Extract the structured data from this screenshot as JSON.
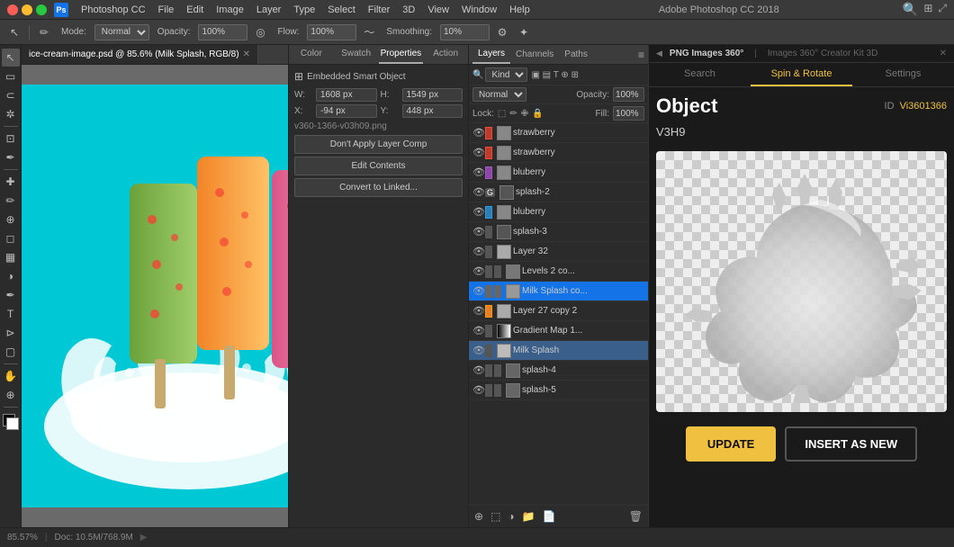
{
  "app": {
    "title": "Adobe Photoshop CC 2018",
    "name": "Photoshop CC"
  },
  "menu": {
    "items": [
      "Photoshop CC",
      "File",
      "Edit",
      "Image",
      "Layer",
      "Type",
      "Select",
      "Filter",
      "3D",
      "View",
      "Window",
      "Help"
    ]
  },
  "toolbar": {
    "mode_label": "Mode:",
    "mode_value": "Normal",
    "opacity_label": "Opacity:",
    "opacity_value": "100%",
    "flow_label": "Flow:",
    "flow_value": "100%",
    "smoothing_label": "Smoothing:",
    "smoothing_value": "10%"
  },
  "canvas": {
    "tab_name": "ice-cream-image.psd @ 85.6% (Milk Splash, RGB/8)",
    "zoom": "85.57%",
    "doc_size": "Doc: 10.5M/768.9M"
  },
  "properties_panel": {
    "tabs": [
      "Color",
      "Swatch",
      "Properties",
      "Action"
    ],
    "active_tab": "Properties",
    "section_title": "Embedded Smart Object",
    "w_label": "W:",
    "w_value": "1608 px",
    "h_label": "H:",
    "h_value": "1549 px",
    "x_label": "X:",
    "x_value": "-94 px",
    "y_label": "Y:",
    "y_value": "448 px",
    "filename": "v360-1366-v03h09.png",
    "apply_layer": "Don't Apply Layer Comp",
    "btn_edit": "Edit Contents",
    "btn_convert": "Convert to Linked..."
  },
  "layers_panel": {
    "tabs": [
      "Layers",
      "Channels",
      "Paths"
    ],
    "active_tab": "Layers",
    "search_placeholder": "Kind",
    "blend_mode": "Normal",
    "opacity_label": "Opacity:",
    "opacity_value": "100%",
    "fill_label": "Fill:",
    "fill_value": "100%",
    "lock_label": "Lock:",
    "layers": [
      {
        "name": "strawberry",
        "visible": true,
        "type": "color",
        "color": "red",
        "indent": 0
      },
      {
        "name": "strawberry",
        "visible": true,
        "type": "color",
        "color": "red",
        "indent": 0
      },
      {
        "name": "bluberry",
        "visible": true,
        "type": "color",
        "color": "purple",
        "indent": 0
      },
      {
        "name": "splash-2",
        "visible": true,
        "type": "smart",
        "color": "normal",
        "indent": 0,
        "has_g": true
      },
      {
        "name": "bluberry",
        "visible": true,
        "type": "color",
        "color": "blue",
        "indent": 0
      },
      {
        "name": "splash-3",
        "visible": true,
        "type": "smart",
        "color": "normal",
        "indent": 0
      },
      {
        "name": "Layer 32",
        "visible": true,
        "type": "normal",
        "color": "normal",
        "indent": 0
      },
      {
        "name": "Levels 2 co...",
        "visible": true,
        "type": "adjustment",
        "color": "normal",
        "indent": 0
      },
      {
        "name": "Milk Splash co...",
        "visible": true,
        "type": "smart",
        "color": "normal",
        "indent": 0,
        "active": true
      },
      {
        "name": "Layer 27 copy 2",
        "visible": true,
        "type": "normal",
        "color": "orange",
        "indent": 0
      },
      {
        "name": "Gradient Map 1...",
        "visible": true,
        "type": "adjustment",
        "color": "normal",
        "indent": 0
      },
      {
        "name": "Milk Splash",
        "visible": true,
        "type": "smart",
        "color": "normal",
        "indent": 0,
        "selected": true
      },
      {
        "name": "splash-4",
        "visible": true,
        "type": "group",
        "color": "normal",
        "indent": 0
      },
      {
        "name": "splash-5",
        "visible": true,
        "type": "group",
        "color": "normal",
        "indent": 0
      }
    ]
  },
  "png_panel": {
    "header_tabs": [
      "PNG Images 360°",
      "Images 360° Creator Kit 3D"
    ],
    "tabs": [
      "Search",
      "Spin & Rotate",
      "Settings"
    ],
    "active_tab": "Spin & Rotate",
    "object_title": "Object",
    "object_id_label": "ID",
    "object_id_value": "Vi3601366",
    "object_subtitle": "V3H9",
    "btn_update": "UPDATE",
    "btn_insert": "INSERT AS NEW"
  },
  "status_bar": {
    "zoom": "85.57%",
    "doc_info": "Doc: 10.5M/768.9M"
  }
}
